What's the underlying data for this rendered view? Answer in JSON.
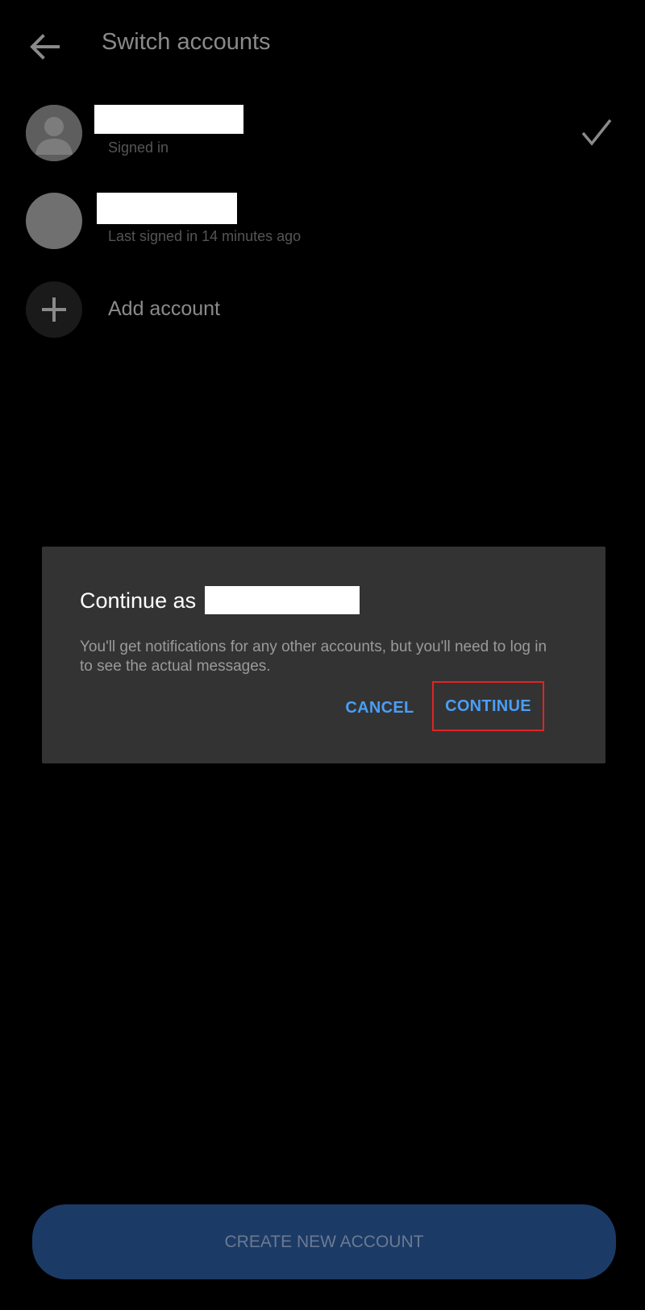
{
  "header": {
    "title": "Switch accounts",
    "back_icon": "arrow-left-icon"
  },
  "accounts": [
    {
      "name": "",
      "status": "Signed in",
      "selected": true,
      "avatar": "default-avatar"
    },
    {
      "name": "",
      "status": "Last signed in 14 minutes ago",
      "selected": false,
      "avatar": "photo-avatar"
    }
  ],
  "add_account": {
    "label": "Add account",
    "icon": "plus-icon"
  },
  "dialog": {
    "title": "Continue as",
    "message": "You'll get notifications for any other accounts, but you'll need to log in to see the actual messages.",
    "cancel_label": "CANCEL",
    "continue_label": "CONTINUE",
    "button_color": "#4a9ef6",
    "highlight_color": "#e02424"
  },
  "footer": {
    "create_label": "CREATE NEW ACCOUNT",
    "button_color": "#1c3a66"
  }
}
